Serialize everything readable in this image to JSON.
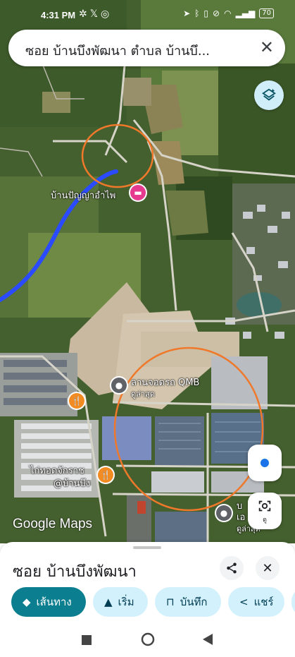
{
  "status_bar": {
    "time": "4:31 PM",
    "left_icons": [
      "network-icon",
      "x-icon",
      "instagram-icon"
    ],
    "right_icons": [
      "location-icon",
      "bluetooth-icon",
      "vibrate-icon",
      "mute-icon",
      "wifi-icon",
      "5g-signal-icon"
    ],
    "battery": "70"
  },
  "search": {
    "query": "ซอย บ้านบึงพัฒนา ตำบล บ้านบึ...",
    "close_icon": "close-icon"
  },
  "map": {
    "places": [
      {
        "name": "บ้านปัญญาอำไพ",
        "icon": "hotel-icon",
        "color": "#e63a8f"
      },
      {
        "name": "ลานจอดรถ QMB",
        "sub": "ดูล่าสุด",
        "icon": "pin-icon",
        "color": "#5f6368"
      },
      {
        "name": "ไก่ทอดจักราช",
        "sub": "@บ้านบึง",
        "icon": "restaurant-icon",
        "color": "#f28b22"
      },
      {
        "name": "บ",
        "sub": "ดูล่าสุด",
        "name2": "เอ",
        "icon": "pin-icon",
        "color": "#5f6368"
      }
    ],
    "restaurant_pin_color": "#f28b22",
    "route_color": "#2a4bff",
    "annotation_color": "#f0782a",
    "google_logo": "Google Maps",
    "layers_icon": "layers-icon",
    "locate_icon": "my-location-icon",
    "lens_icon": "lens-icon",
    "lens_label": "ดู"
  },
  "sheet": {
    "title": "ซอย บ้านบึงพัฒนา",
    "share_icon": "share-icon",
    "close_icon": "close-icon",
    "chips": [
      {
        "label": "เส้นทาง",
        "icon": "directions-icon",
        "primary": true
      },
      {
        "label": "เริ่ม",
        "icon": "navigation-icon",
        "primary": false
      },
      {
        "label": "บันทึก",
        "icon": "bookmark-icon",
        "primary": false
      },
      {
        "label": "แชร์",
        "icon": "share-icon",
        "primary": false
      }
    ]
  },
  "nav_bar": {
    "buttons": [
      "recents-icon",
      "home-icon",
      "back-icon"
    ]
  },
  "colors": {
    "accent": "#0b7e8f",
    "chip_bg": "#d3f1fc"
  }
}
